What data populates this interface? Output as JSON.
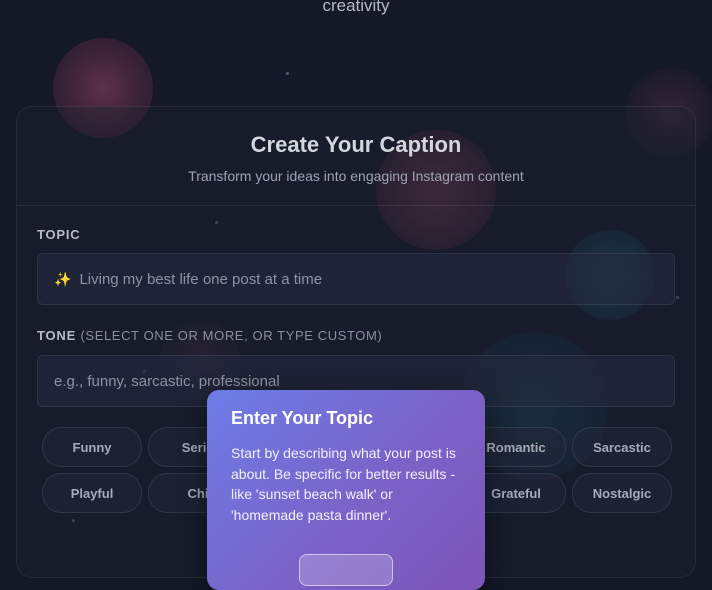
{
  "header": {
    "top_word": "creativity"
  },
  "card": {
    "title": "Create Your Caption",
    "subtitle": "Transform your ideas into engaging Instagram content"
  },
  "topic": {
    "label": "TOPIC",
    "placeholder": "Living my best life one post at a time",
    "placeholder_icon": "sparkles-icon"
  },
  "tone": {
    "label": "TONE",
    "hint": "(SELECT ONE OR MORE, OR TYPE CUSTOM)",
    "placeholder": "e.g., funny, sarcastic, professional",
    "chips": [
      "Funny",
      "Serio",
      "Romantic",
      "Sarcastic",
      "Playful",
      "Chi",
      "Grateful",
      "Nostalgic"
    ]
  },
  "tour_modal": {
    "title": "Enter Your Topic",
    "body": "Start by describing what your post is about. Be specific for better results - like 'sunset beach walk' or 'homemade pasta dinner'."
  },
  "colors": {
    "background": "#141827",
    "modal_gradient_start": "#6c7de6",
    "modal_gradient_end": "#7c55b8"
  }
}
